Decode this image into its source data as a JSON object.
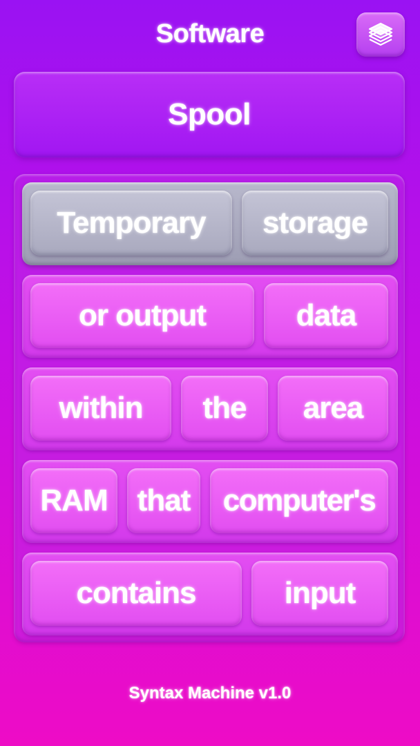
{
  "header": {
    "category": "Software",
    "deck_icon": "card-deck-icon"
  },
  "word": "Spool",
  "rows": [
    {
      "tiles": [
        "Temporary",
        "storage"
      ],
      "state": "selected"
    },
    {
      "tiles": [
        "or output",
        "data"
      ]
    },
    {
      "tiles": [
        "within",
        "the",
        "area"
      ]
    },
    {
      "tiles": [
        "RAM",
        "that",
        "computer's"
      ]
    },
    {
      "tiles": [
        "contains",
        "input"
      ]
    }
  ],
  "footer": {
    "version": "Syntax Machine v1.0"
  },
  "colors": {
    "background_top": "#9a12f3",
    "background_bottom": "#ee0cc6",
    "tile": "#e24ef1",
    "selected_row": "#a9a9be"
  }
}
